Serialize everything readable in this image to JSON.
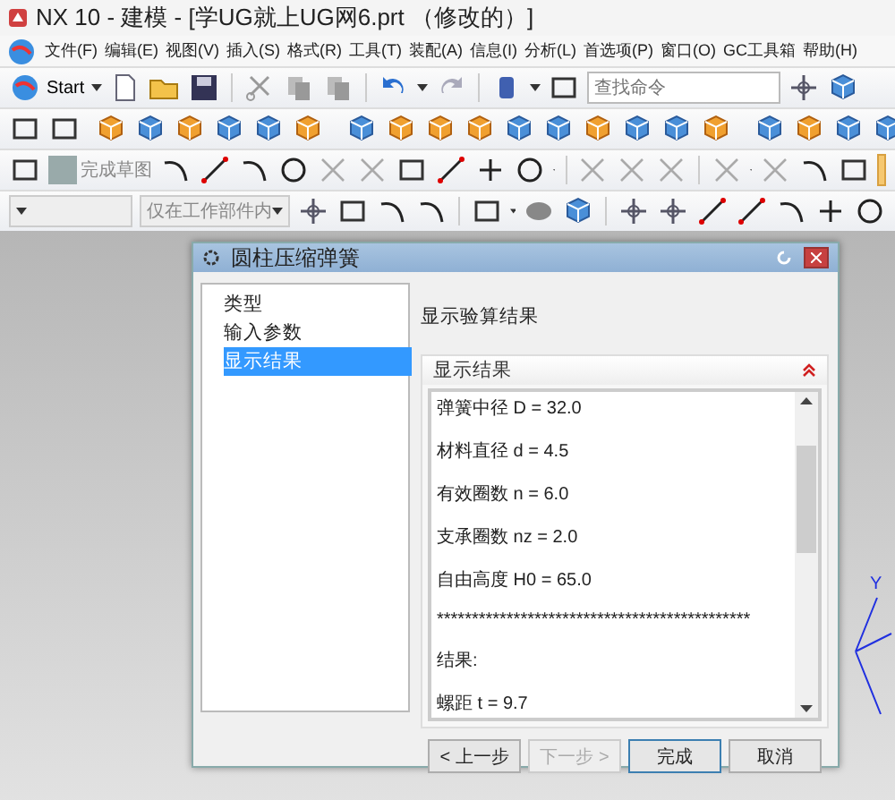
{
  "window": {
    "title": "NX 10 - 建模 - [学UG就上UG网6.prt （修改的）]"
  },
  "menu": [
    "文件(F)",
    "编辑(E)",
    "视图(V)",
    "插入(S)",
    "格式(R)",
    "工具(T)",
    "装配(A)",
    "信息(I)",
    "分析(L)",
    "首选项(P)",
    "窗口(O)",
    "GC工具箱",
    "帮助(H)"
  ],
  "toolbar": {
    "start_label": "Start",
    "search": {
      "placeholder": "查找命令"
    },
    "finish_sketch": "完成草图",
    "filter": {
      "value": "仅在工作部件内"
    }
  },
  "dialog": {
    "title": "圆柱压缩弹簧",
    "nav": [
      {
        "label": "类型",
        "selected": false
      },
      {
        "label": "输入参数",
        "selected": false
      },
      {
        "label": "显示结果",
        "selected": true
      }
    ],
    "heading": "显示验算结果",
    "group": {
      "title": "显示结果",
      "expanded": true,
      "lines": [
        "弹簧中径 D = 32.0",
        "材料直径 d = 4.5",
        "有效圈数 n = 6.0",
        "支承圈数 nz = 2.0",
        "自由高度 H0 = 65.0",
        "*********************************************",
        "结果:",
        "螺距 t = 9.7"
      ]
    },
    "buttons": [
      {
        "label": "< 上一步",
        "disabled": false
      },
      {
        "label": "下一步 >",
        "disabled": true
      },
      {
        "label": "完成",
        "disabled": false
      },
      {
        "label": "取消",
        "disabled": false
      }
    ]
  },
  "axis": {
    "label": "Y"
  }
}
